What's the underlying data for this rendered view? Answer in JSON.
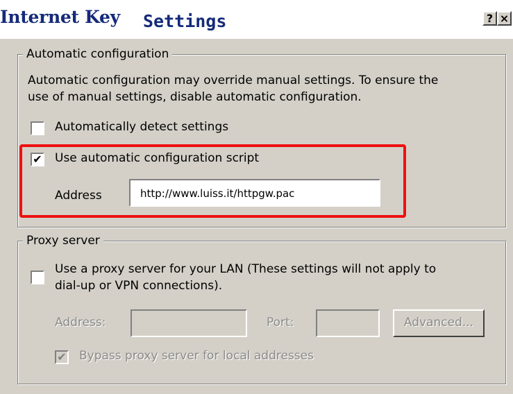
{
  "window": {
    "title_part1": "Internet Key",
    "title_part2": "Settings",
    "help_label": "?",
    "close_label": "×"
  },
  "auto_config": {
    "legend": "Automatic configuration",
    "description_line1": "Automatic configuration may override manual settings.  To ensure the",
    "description_line2": "use of manual settings, disable automatic configuration.",
    "detect_settings": {
      "label": "Automatically detect settings",
      "checked": false
    },
    "use_script": {
      "label": "Use automatic configuration script",
      "checked": true
    },
    "address_label": "Address",
    "address_value": "http://www.luiss.it/httpgw.pac"
  },
  "proxy": {
    "legend": "Proxy server",
    "use_proxy": {
      "label_line1": "Use a proxy server for your LAN (These settings will not apply to",
      "label_line2": "dial-up or VPN connections).",
      "checked": false
    },
    "address_label": "Address:",
    "address_value": "",
    "port_label": "Port:",
    "port_value": "",
    "advanced_label": "Advanced...",
    "bypass": {
      "label": "Bypass proxy server for local addresses",
      "checked": true
    }
  },
  "colors": {
    "title_text": "#152a7a",
    "highlight": "#ee1111",
    "dialog_bg": "#d4d0c8"
  }
}
